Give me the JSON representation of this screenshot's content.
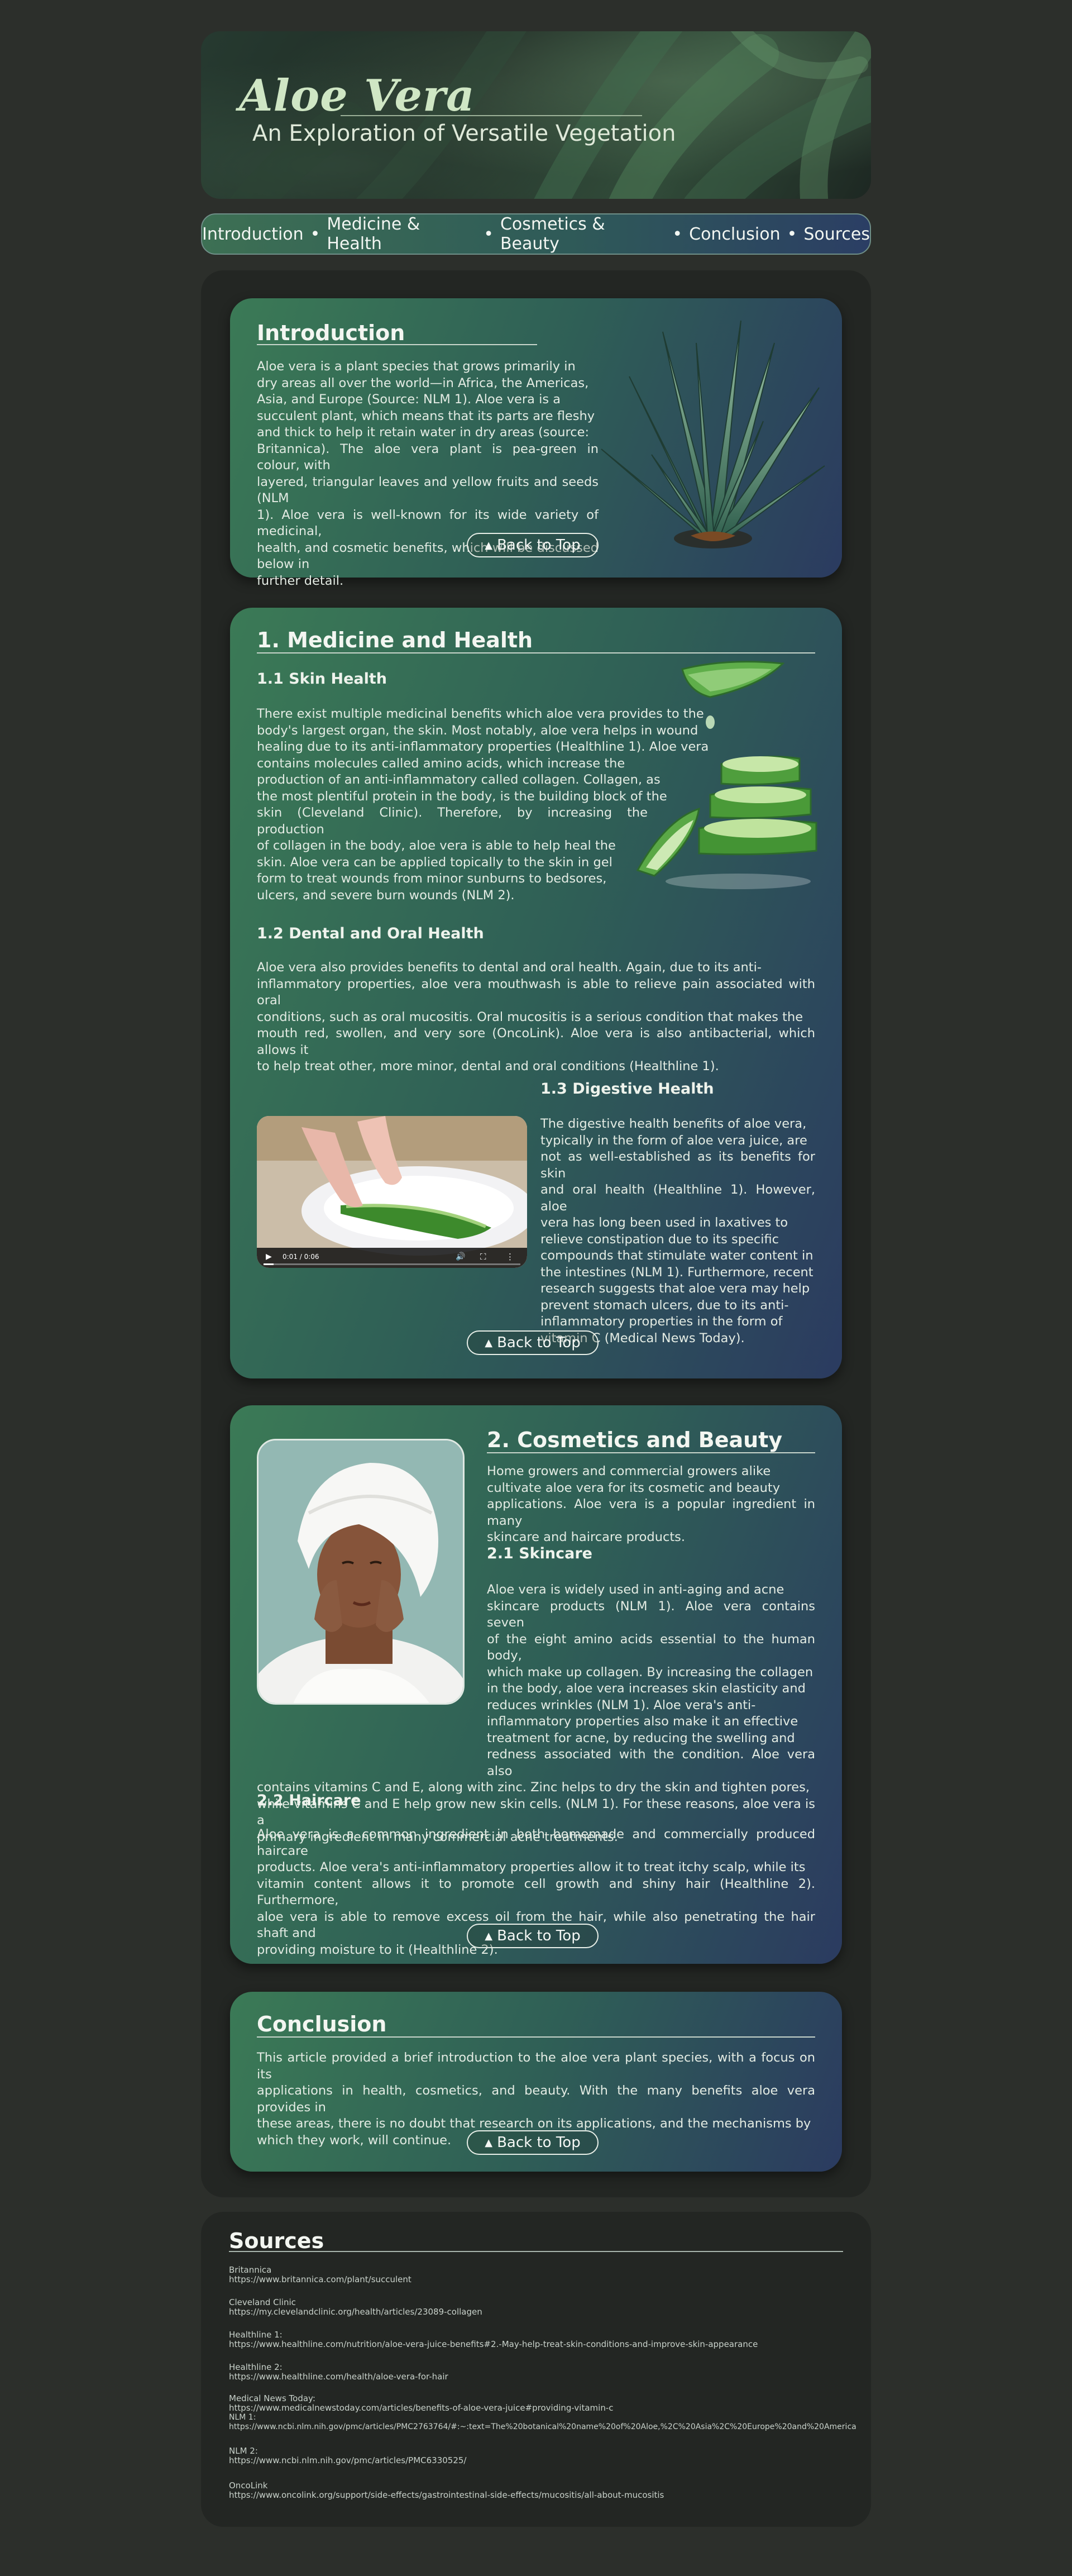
{
  "header": {
    "title": "Aloe Vera",
    "subtitle": "An Exploration of Versatile Vegetation"
  },
  "nav": {
    "items": [
      "Introduction",
      "Medicine & Health",
      "Cosmetics & Beauty",
      "Conclusion",
      "Sources"
    ],
    "separator": "•"
  },
  "back_to_top": "Back to Top",
  "intro": {
    "heading": "Introduction",
    "lines": [
      "Aloe vera is a plant species that grows primarily in",
      "dry areas all over the world—in Africa, the Americas,",
      "Asia, and Europe (Source: NLM 1). Aloe vera is a",
      "succulent plant, which means that its parts are fleshy",
      "and thick to help it retain water in dry areas (source:",
      "Britannica). The aloe vera plant is pea-green in colour, with",
      "layered, triangular leaves and yellow fruits and seeds (NLM",
      "1). Aloe vera is well-known for its wide variety of medicinal,",
      "health, and cosmetic benefits, which will be discussed below in",
      "further detail."
    ]
  },
  "medicine": {
    "heading": "1. Medicine and Health",
    "skin_heading": "1.1 Skin Health",
    "skin_lines": [
      "There exist multiple medicinal benefits which aloe vera provides to the",
      "body's largest organ, the skin. Most notably, aloe vera helps in wound",
      "healing due to its anti-inflammatory properties (Healthline 1). Aloe vera",
      "contains molecules called amino acids, which increase the",
      "production of an anti-inflammatory called collagen. Collagen, as",
      "the most plentiful protein in the body, is the building block of the",
      "skin (Cleveland Clinic). Therefore, by increasing the production",
      "of collagen in the body, aloe vera is able to help heal the",
      "skin. Aloe vera can be applied topically to the skin in gel",
      "form to treat wounds from minor sunburns to bedsores,",
      "ulcers, and severe burn wounds (NLM 2)."
    ],
    "dental_heading": "1.2 Dental and Oral Health",
    "dental_lines": [
      "Aloe vera also provides benefits to dental and oral health. Again, due to its anti-",
      "inflammatory properties, aloe vera mouthwash is able to relieve pain associated with oral",
      "conditions, such as oral mucositis. Oral mucositis is a serious condition that makes the",
      "mouth red, swollen, and very sore (OncoLink). Aloe vera is also antibacterial, which allows it",
      "to help treat other, more minor, dental and oral conditions (Healthline 1)."
    ],
    "digestive_heading": "1.3 Digestive Health",
    "digestive_lines": [
      "The digestive health benefits of aloe vera,",
      "typically in the form of aloe vera juice, are",
      "not as well-established as its benefits for skin",
      "and oral health (Healthline 1). However, aloe",
      "vera has long been used in laxatives to",
      "relieve constipation due to its specific",
      "compounds that stimulate water content in",
      "the intestines (NLM 1). Furthermore, recent",
      "research suggests that aloe vera may help",
      "prevent stomach ulcers, due to its anti-",
      "inflammatory properties in the form of",
      "vitamin C (Medical News Today)."
    ],
    "video_time": "0:01 / 0:06"
  },
  "cosmetics": {
    "heading": "2. Cosmetics and Beauty",
    "intro_lines": [
      "Home growers and commercial growers alike",
      "cultivate aloe vera for its cosmetic and beauty",
      "applications. Aloe vera is a popular ingredient in many",
      "skincare and haircare products."
    ],
    "skincare_heading": "2.1 Skincare",
    "skincare_lines": [
      "Aloe vera is widely used in anti-aging and acne",
      "skincare products (NLM 1). Aloe vera contains seven",
      "of the eight amino acids essential to the human body,",
      "which make up collagen. By increasing the collagen",
      "in the body, aloe vera increases skin elasticity and",
      "reduces wrinkles (NLM 1). Aloe vera's anti-",
      "inflammatory properties also make it an effective",
      "treatment for acne, by reducing the swelling and",
      "redness associated with the condition. Aloe vera also",
      "contains vitamins C and E, along with zinc. Zinc helps to dry the skin and tighten pores,",
      "while vitamins C and E help grow new skin cells. (NLM 1). For these reasons, aloe vera is a",
      "primary ingredient in many commercial acne treatments."
    ],
    "haircare_heading": "2.2 Haircare",
    "haircare_lines": [
      "Aloe vera is a common ingredient in both homemade and commercially produced haircare",
      "products. Aloe vera's anti-inflammatory properties allow it to treat itchy scalp, while its",
      "vitamin content allows it to promote cell growth and shiny hair (Healthline 2). Furthermore,",
      "aloe vera is able to remove excess oil from the hair, while also penetrating the hair shaft and",
      "providing moisture to it (Healthline 2)."
    ]
  },
  "conclusion": {
    "heading": "Conclusion",
    "lines": [
      "This article provided a brief introduction to the aloe vera plant species, with a focus on its",
      "applications in health, cosmetics, and beauty. With the many benefits aloe vera provides in",
      "these areas, there is no doubt that research on its applications, and the mechanisms by",
      "which they work, will continue."
    ]
  },
  "sources": {
    "heading": "Sources",
    "entries": [
      {
        "name": "Britannica",
        "url": "https://www.britannica.com/plant/succulent"
      },
      {
        "name": "Cleveland Clinic",
        "url": "https://my.clevelandclinic.org/health/articles/23089-collagen"
      },
      {
        "name": "Healthline 1:",
        "url": "https://www.healthline.com/nutrition/aloe-vera-juice-benefits#2.-May-help-treat-skin-conditions-and-improve-skin-appearance"
      },
      {
        "name": "Healthline 2:",
        "url": "https://www.healthline.com/health/aloe-vera-for-hair"
      },
      {
        "name": "Medical News Today:",
        "url": "https://www.medicalnewstoday.com/articles/benefits-of-aloe-vera-juice#providing-vitamin-c"
      },
      {
        "name": "NLM 1:",
        "url": "https://www.ncbi.nlm.nih.gov/pmc/articles/PMC2763764/#:~:text=The%20botanical%20name%20of%20Aloe,%2C%20Asia%2C%20Europe%20and%20America"
      },
      {
        "name": "NLM 2:",
        "url": "https://www.ncbi.nlm.nih.gov/pmc/articles/PMC6330525/"
      },
      {
        "name": "OncoLink",
        "url": "https://www.oncolink.org/support/side-effects/gastrointestinal-side-effects/mucositis/all-about-mucositis"
      }
    ]
  }
}
